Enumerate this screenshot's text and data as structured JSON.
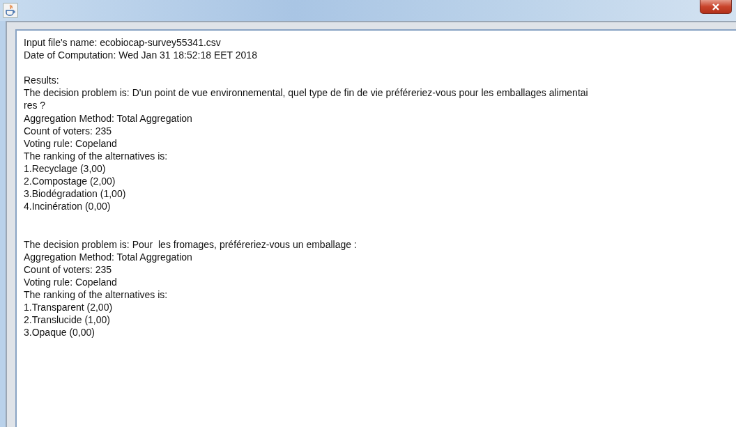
{
  "text_area": {
    "lines": [
      {
        "kind": "text",
        "text": "Input file's name: ecobiocap-survey55341.csv"
      },
      {
        "kind": "text",
        "text": "Date of Computation: Wed Jan 31 18:52:18 EET 2018"
      },
      {
        "kind": "blank"
      },
      {
        "kind": "text",
        "text": "Results:"
      },
      {
        "kind": "text",
        "text": "The decision problem is: D'un point de vue environnemental, quel type de fin de vie préféreriez-vous pour les emballages alimentai"
      },
      {
        "kind": "text",
        "text": "res ?"
      },
      {
        "kind": "text",
        "text": "Aggregation Method: Total Aggregation"
      },
      {
        "kind": "text",
        "text": "Count of voters: 235"
      },
      {
        "kind": "text",
        "text": "Voting rule: Copeland"
      },
      {
        "kind": "text",
        "text": "The ranking of the alternatives is:"
      },
      {
        "kind": "text",
        "text": "1.Recyclage (3,00)"
      },
      {
        "kind": "text",
        "text": "2.Compostage (2,00)"
      },
      {
        "kind": "text",
        "text": "3.Biodégradation (1,00)"
      },
      {
        "kind": "text",
        "text": "4.Incinération (0,00)"
      },
      {
        "kind": "blank"
      },
      {
        "kind": "blank"
      },
      {
        "kind": "text",
        "text": "The decision problem is: Pour  les fromages, préféreriez-vous un emballage :"
      },
      {
        "kind": "text",
        "text": "Aggregation Method: Total Aggregation"
      },
      {
        "kind": "text",
        "text": "Count of voters: 235"
      },
      {
        "kind": "text",
        "text": "Voting rule: Copeland"
      },
      {
        "kind": "text",
        "text": "The ranking of the alternatives is:"
      },
      {
        "kind": "text",
        "text": "1.Transparent (2,00)"
      },
      {
        "kind": "text",
        "text": "2.Translucide (1,00)"
      },
      {
        "kind": "text",
        "text": "3.Opaque (0,00)"
      }
    ]
  }
}
